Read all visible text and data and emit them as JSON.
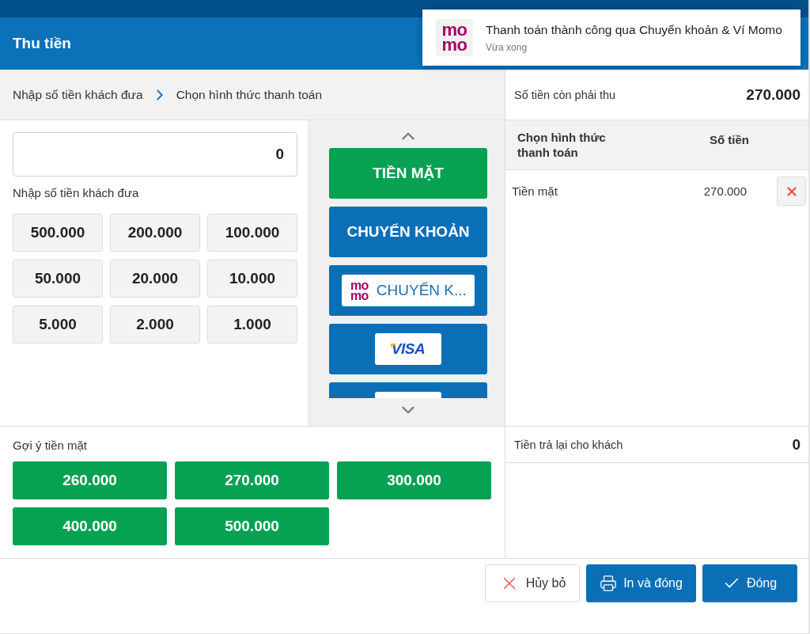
{
  "window": {
    "title": "Thu tiền"
  },
  "notification": {
    "logo": [
      "mo",
      "mo"
    ],
    "message": "Thanh toán thành công qua Chuyển khoản & Ví Momo",
    "time": "Vừa xong"
  },
  "steps": [
    "Nhập số tiền khách đưa",
    "Chọn hình thức thanh toán"
  ],
  "cash_input": {
    "value": "0",
    "label": "Nhập số tiền khách đưa"
  },
  "denominations": [
    "500.000",
    "200.000",
    "100.000",
    "50.000",
    "20.000",
    "10.000",
    "5.000",
    "2.000",
    "1.000"
  ],
  "payment_methods": [
    {
      "kind": "text",
      "label": "TIỀN MẶT",
      "selected": true
    },
    {
      "kind": "text",
      "label": "CHUYỂN KHOẢN",
      "selected": false
    },
    {
      "kind": "momo",
      "logo": [
        "mo",
        "mo"
      ],
      "label": "CHUYỂN K...",
      "selected": false
    },
    {
      "kind": "visa",
      "logo": "VISA",
      "selected": false
    },
    {
      "kind": "card",
      "selected": false
    }
  ],
  "suggestions": {
    "title": "Gợi ý tiền mặt",
    "amounts": [
      "260.000",
      "270.000",
      "300.000",
      "400.000",
      "500.000"
    ]
  },
  "summary": {
    "label": "Số tiền còn phải thu",
    "value": "270.000"
  },
  "payments_table": {
    "columns": [
      "Chọn hình thức thanh toán",
      "Số tiền"
    ],
    "rows": [
      {
        "method": "Tiền mặt",
        "amount": "270.000"
      }
    ]
  },
  "change": {
    "label": "Tiền trả lại cho khách",
    "value": "0"
  },
  "buttons": [
    {
      "kind": "cancel",
      "label": "Hủy bỏ"
    },
    {
      "kind": "print",
      "label": "In và đóng"
    },
    {
      "kind": "confirm",
      "label": "Đóng"
    }
  ]
}
